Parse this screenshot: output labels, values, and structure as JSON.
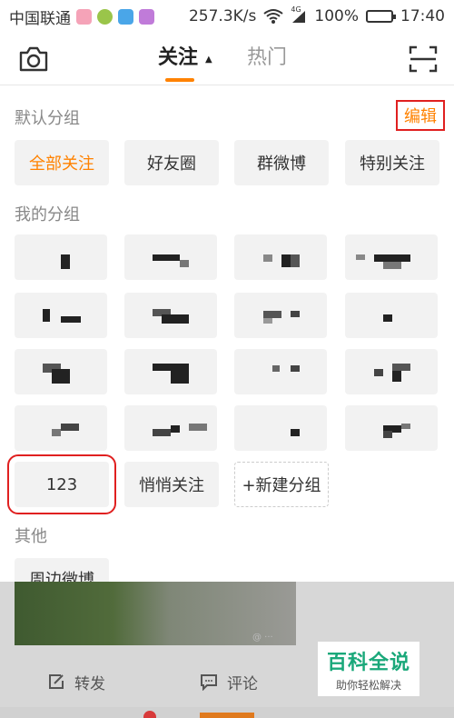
{
  "status_bar": {
    "carrier": "中国联通",
    "speed": "257.3K/s",
    "network": "4G",
    "battery_percent": "100%",
    "battery_level": 1.0,
    "time": "17:40"
  },
  "nav": {
    "tabs": [
      {
        "label": "关注",
        "active": true
      },
      {
        "label": "热门",
        "active": false
      }
    ]
  },
  "panel": {
    "default_groups_label": "默认分组",
    "edit_label": "编辑",
    "default_groups": [
      "全部关注",
      "好友圈",
      "群微博",
      "特别关注"
    ],
    "my_groups_label": "我的分组",
    "my_groups_extra": [
      "123",
      "悄悄关注"
    ],
    "new_group_label": "+新建分组",
    "other_label": "其他",
    "other_groups": [
      "周边微博"
    ]
  },
  "feed": {
    "repost_label": "转发",
    "comment_label": "评论"
  },
  "watermark": {
    "title": "百科全说",
    "subtitle": "助你轻松解决"
  },
  "colors": {
    "accent": "#ff8200",
    "highlight_frame": "#e02020",
    "chip_bg": "#f2f2f2"
  }
}
